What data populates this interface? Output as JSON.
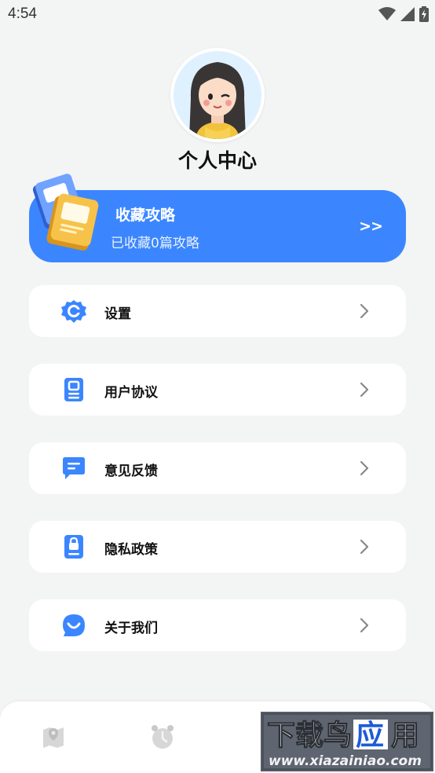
{
  "status": {
    "time": "4:54"
  },
  "header": {
    "title": "个人中心"
  },
  "favorites": {
    "title": "收藏攻略",
    "subtitle": "已收藏0篇攻略",
    "arrow": ">>"
  },
  "menu": [
    {
      "label": "设置",
      "icon": "gear-icon"
    },
    {
      "label": "用户协议",
      "icon": "document-icon"
    },
    {
      "label": "意见反馈",
      "icon": "message-icon"
    },
    {
      "label": "隐私政策",
      "icon": "lock-document-icon"
    },
    {
      "label": "关于我们",
      "icon": "smile-chat-icon"
    }
  ],
  "watermark": {
    "title": "下载鸟应用",
    "url": "www.xiazainiao.com"
  },
  "colors": {
    "accent": "#3b86ff",
    "background": "#f3f4f4"
  }
}
